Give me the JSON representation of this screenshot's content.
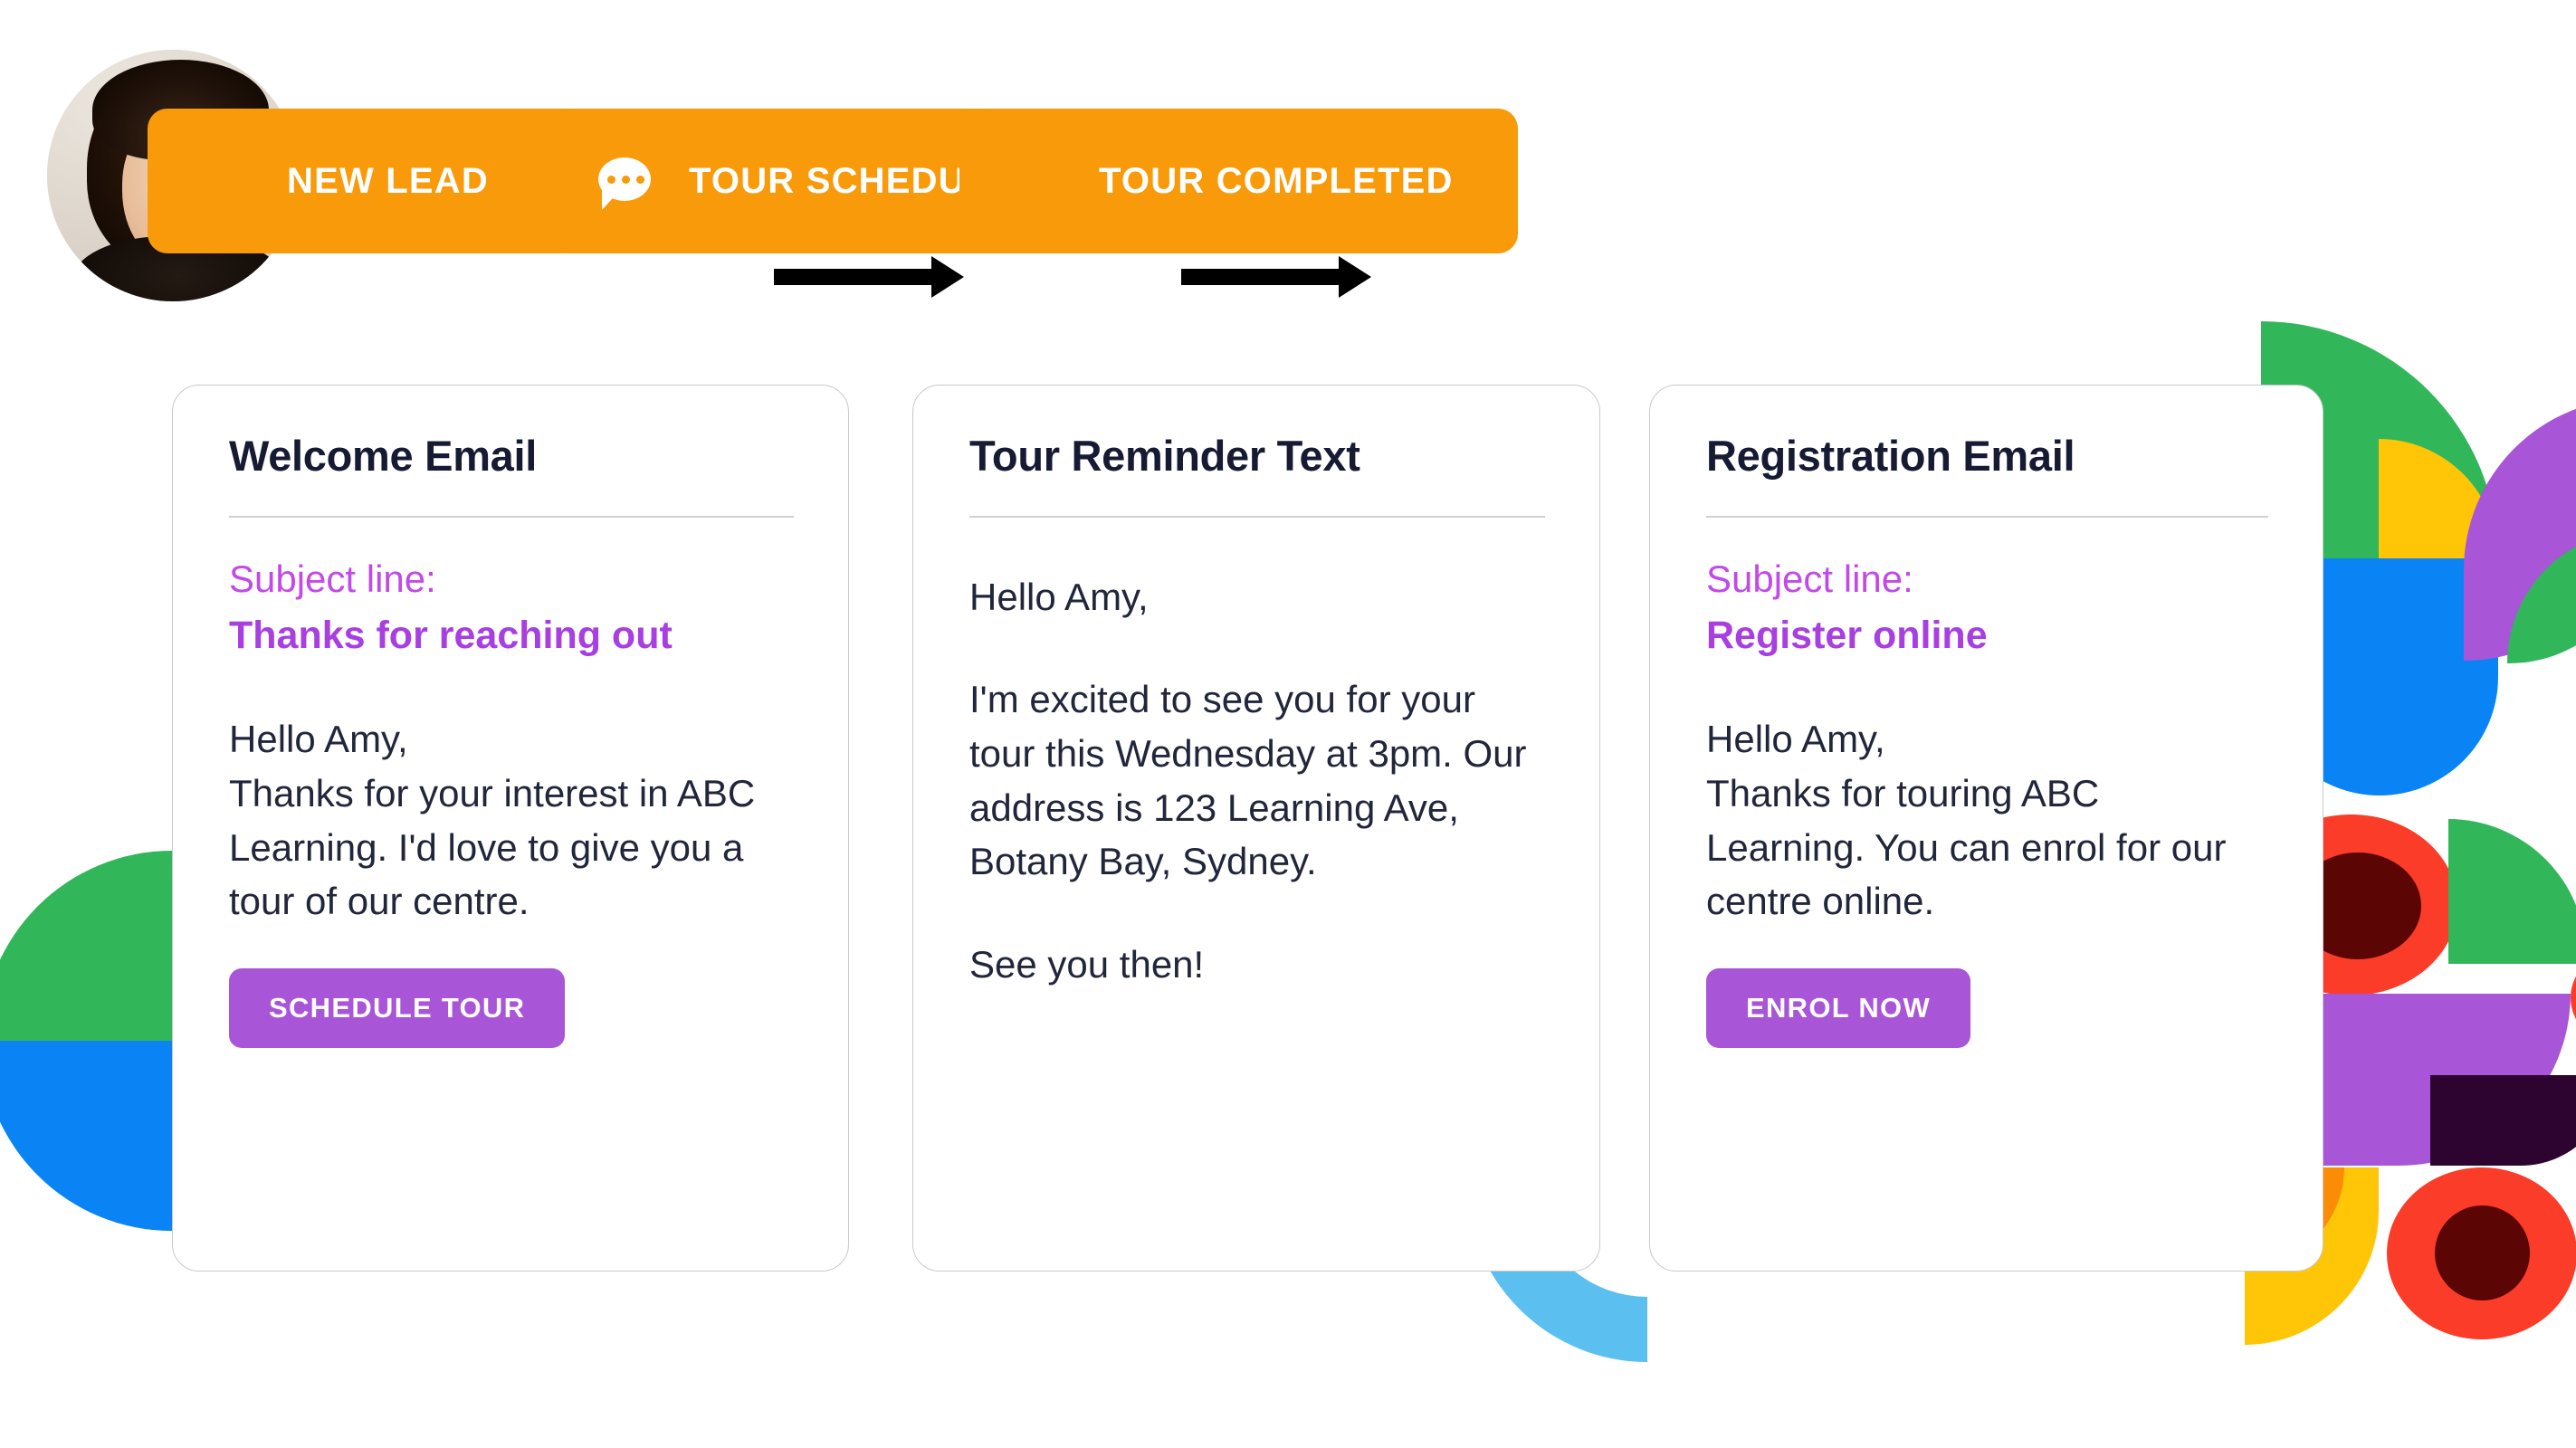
{
  "flow": {
    "persona": {
      "alt": "smiling woman portrait"
    },
    "stages": [
      {
        "id": "new-lead",
        "label": "NEW LEAD",
        "icon": "envelope-icon"
      },
      {
        "id": "tour-scheduled",
        "label": "TOUR SCHEDULED",
        "icon": "chat-bubble-icon"
      },
      {
        "id": "tour-completed",
        "label": "TOUR COMPLETED",
        "icon": "envelope-icon"
      }
    ],
    "connectors": [
      "arrow-right-icon",
      "arrow-right-icon"
    ]
  },
  "cards": [
    {
      "id": "welcome-email",
      "title": "Welcome Email",
      "subject_label": "Subject line:",
      "subject_value": "Thanks for reaching out",
      "body": "Hello Amy,\nThanks for your interest in ABC Learning. I'd love to give you a tour of our centre.",
      "cta": "SCHEDULE TOUR"
    },
    {
      "id": "tour-reminder-text",
      "title": "Tour Reminder Text",
      "subject_label": "",
      "subject_value": "",
      "body": "Hello Amy,",
      "body2": "I'm excited to see you for your tour this Wednesday at 3pm. Our address is 123 Learning Ave, Botany Bay, Sydney.",
      "body3": "See you then!",
      "cta": ""
    },
    {
      "id": "registration-email",
      "title": "Registration Email",
      "subject_label": "Subject line:",
      "subject_value": "Register online",
      "body": "Hello Amy,\nThanks for touring ABC Learning. You can enrol for our centre online.",
      "cta": "ENROL NOW"
    }
  ],
  "colors": {
    "stage_badge": "#F89A09",
    "cta_purple": "#A855D8",
    "subject_label_purple": "#C24AE8",
    "subject_value_purple": "#A83FE0",
    "heading_navy": "#161B33",
    "body_text": "#21263B",
    "card_border": "#C9C9C9",
    "arrow_black": "#000000",
    "deco_green": "#32B65A",
    "deco_yellow": "#FFC507",
    "deco_blue": "#0A84F5",
    "deco_light_blue": "#5BC0F0",
    "deco_red": "#FA3C28",
    "deco_dark_red": "#5C0505",
    "deco_purple": "#A855D8",
    "deco_dark_purple": "#2D0430",
    "deco_orange": "#FB8C05"
  }
}
